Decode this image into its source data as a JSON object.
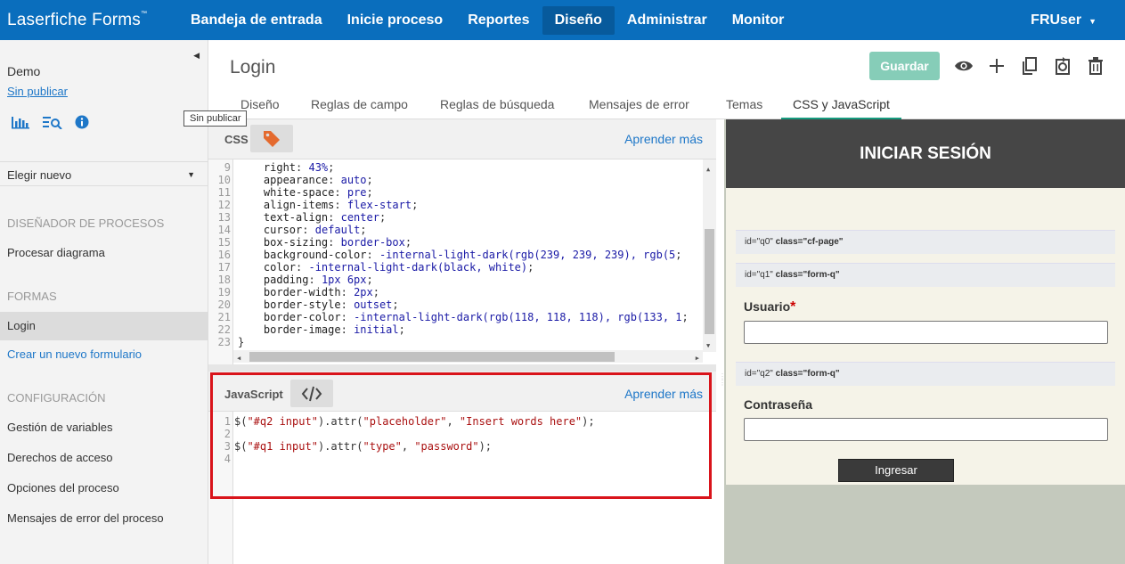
{
  "topnav": {
    "brand": "Laserfiche Forms",
    "brand_tm": "™",
    "items": [
      "Bandeja de entrada",
      "Inicie proceso",
      "Reportes",
      "Diseño",
      "Administrar",
      "Monitor"
    ],
    "active_item": "Diseño",
    "user": "FRUser"
  },
  "sidebar": {
    "process_name": "Demo",
    "status_link": "Sin publicar",
    "tooltip": "Sin publicar",
    "icons": [
      "bar-chart-icon",
      "search-list-icon",
      "info-icon"
    ],
    "select_label": "Elegir nuevo",
    "sections": [
      {
        "heading": "DISEÑADOR DE PROCESOS",
        "items": [
          "Procesar diagrama"
        ]
      },
      {
        "heading": "FORMAS",
        "items": [
          "Login",
          "Crear un nuevo formulario"
        ]
      },
      {
        "heading": "CONFIGURACIÓN",
        "items": [
          "Gestión de variables",
          "Derechos de acceso",
          "Opciones del proceso",
          "Mensajes de error del proceso"
        ]
      }
    ],
    "active_item": "Login"
  },
  "main": {
    "title": "Login",
    "save_label": "Guardar",
    "tool_icons": [
      "preview-eye-icon",
      "add-icon",
      "copy-icon",
      "sync-icon",
      "trash-icon"
    ],
    "tabs": [
      "Diseño",
      "Reglas de campo",
      "Reglas de búsqueda",
      "Mensajes de error",
      "Temas",
      "CSS y JavaScript"
    ],
    "active_tab": "CSS y JavaScript"
  },
  "css_panel": {
    "label": "CSS",
    "learn_more": "Aprender más",
    "lines": [
      {
        "n": "9",
        "prop": "right",
        "val": "43%"
      },
      {
        "n": "10",
        "prop": "appearance",
        "val": "auto"
      },
      {
        "n": "11",
        "prop": "white-space",
        "val": "pre"
      },
      {
        "n": "12",
        "prop": "align-items",
        "val": "flex-start"
      },
      {
        "n": "13",
        "prop": "text-align",
        "val": "center"
      },
      {
        "n": "14",
        "prop": "cursor",
        "val": "default"
      },
      {
        "n": "15",
        "prop": "box-sizing",
        "val": "border-box"
      },
      {
        "n": "16",
        "prop": "background-color",
        "val": "-internal-light-dark(rgb(239, 239, 239), rgb(5"
      },
      {
        "n": "17",
        "prop": "color",
        "val": "-internal-light-dark(black, white)"
      },
      {
        "n": "18",
        "prop": "padding",
        "val": "1px 6px"
      },
      {
        "n": "19",
        "prop": "border-width",
        "val": "2px"
      },
      {
        "n": "20",
        "prop": "border-style",
        "val": "outset"
      },
      {
        "n": "21",
        "prop": "border-color",
        "val": "-internal-light-dark(rgb(118, 118, 118), rgb(133, 1"
      },
      {
        "n": "22",
        "prop": "border-image",
        "val": "initial"
      }
    ],
    "close_line": {
      "n": "23",
      "text": "}"
    }
  },
  "js_panel": {
    "label": "JavaScript",
    "learn_more": "Aprender más",
    "lines": [
      {
        "n": "1",
        "pre": "$(",
        "sel": "\"#q2 input\"",
        "mid": ").attr(",
        "a1": "\"placeholder\"",
        "sep": ", ",
        "a2": "\"Insert words here\"",
        "end": ");"
      },
      {
        "n": "2",
        "pre": "",
        "sel": "",
        "mid": "",
        "a1": "",
        "sep": "",
        "a2": "",
        "end": ""
      },
      {
        "n": "3",
        "pre": "$(",
        "sel": "\"#q1 input\"",
        "mid": ").attr(",
        "a1": "\"type\"",
        "sep": ", ",
        "a2": "\"password\"",
        "end": ");"
      },
      {
        "n": "4",
        "pre": "",
        "sel": "",
        "mid": "",
        "a1": "",
        "sep": "",
        "a2": "",
        "end": ""
      }
    ]
  },
  "preview": {
    "header": "INICIAR SESIÓN",
    "id_bars": [
      {
        "id": "id=\"q0\"",
        "cls": "class=\"cf-page\""
      },
      {
        "id": "id=\"q1\"",
        "cls": "class=\"form-q\""
      },
      {
        "id": "id=\"q2\"",
        "cls": "class=\"form-q\""
      }
    ],
    "username_label": "Usuario",
    "required_mark": "*",
    "password_label": "Contraseña",
    "submit_label": "Ingresar"
  },
  "colors": {
    "nav": "#0a6ebd",
    "save": "#86cdb8",
    "highlight": "#d9141b",
    "tab_active": "#179b7f"
  }
}
